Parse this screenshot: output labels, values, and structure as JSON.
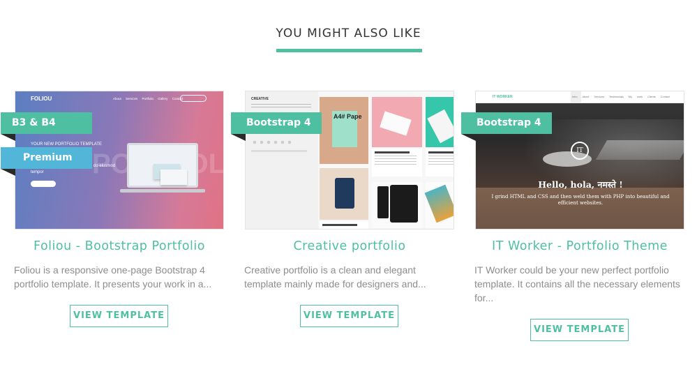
{
  "section": {
    "title": "YOU MIGHT ALSO LIKE"
  },
  "cards": [
    {
      "ribbons": [
        "B3 & B4",
        "Premium"
      ],
      "title": "Foliou - Bootstrap Portfolio",
      "description": "Foliou is a responsive one-page Bootstrap 4 portfolio template. It presents your work in a...",
      "button": "VIEW TEMPLATE",
      "thumb": {
        "logo": "FOLIOU",
        "nav": "About Services Portfolio Gallery Contact",
        "tagline": "YOUR NEW PORTFOLIO TEMPLATE",
        "text": "... consectetur adipiscing elit, sed do eiusmod tempor",
        "big": "PORTFOLIO"
      }
    },
    {
      "ribbons": [
        "Bootstrap 4"
      ],
      "title": "Creative portfolio",
      "description": "Creative portfolio is a clean and elegant template mainly made for designers and...",
      "button": "VIEW TEMPLATE",
      "thumb": {
        "side_title": "CREATIVE",
        "a4": "A4# Pape",
        "meta1": "NAME OF THE WORK 2",
        "meta2": "NAME OF THE WORK",
        "meta3": "NAME OF THE WORK 7"
      }
    },
    {
      "ribbons": [
        "Bootstrap 4"
      ],
      "title": "IT Worker - Portfolio Theme",
      "description": "IT Worker could be your new perfect portfolio template. It contains all the necessary elements for...",
      "button": "VIEW TEMPLATE",
      "thumb": {
        "brand": "IT WORKER",
        "nav": "Intro About Services Testimonials My work Clients Contact",
        "badge": "IT",
        "hello": "Hello, hola, नमस्ते !",
        "sub": "I grind HTML and CSS and then weld them with PHP into beautiful and efficient websites."
      }
    }
  ],
  "colors": {
    "accent": "#4fbfa2",
    "ribbon_blue": "#52b6d8",
    "text_muted": "#8d8d8d"
  }
}
